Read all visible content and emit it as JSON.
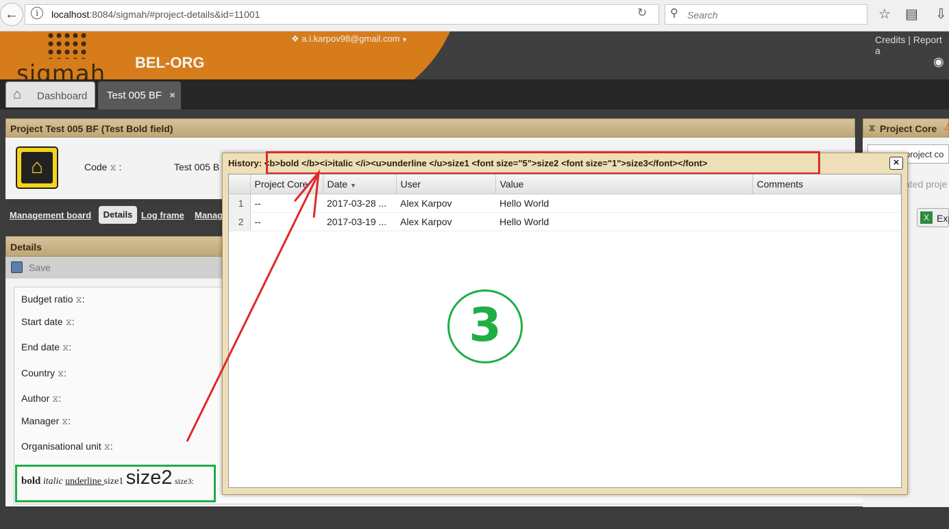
{
  "browser": {
    "url_host": "localhost",
    "url_rest": ":8084/sigmah/#project-details&id=11001",
    "search_placeholder": "Search"
  },
  "header": {
    "logo_text": "sigmah",
    "org": "BEL-ORG",
    "user": "a.i.karpov98@gmail.com",
    "links": "Credits | Report a"
  },
  "tabs": {
    "dashboard": "Dashboard",
    "project": "Test 005 BF"
  },
  "project": {
    "title": "Project Test 005 BF (Test Bold field)",
    "code_label": "Code",
    "code_value": "Test 005 B"
  },
  "subtabs": [
    "Management board",
    "Details",
    "Log frame",
    "Manag"
  ],
  "details": {
    "title": "Details",
    "save_label": "Save",
    "fields": [
      "Budget ratio",
      "Start date",
      "End date",
      "Country",
      "Author",
      "Manager",
      "Organisational unit"
    ],
    "rich": {
      "bold": "bold",
      "italic": "italic",
      "underline": "underline ",
      "size1": "size1",
      "size2": "size2",
      "size3": "size3:"
    }
  },
  "right_panel": {
    "title": "Project Core",
    "select_text": "project co",
    "stated": "ated proje",
    "export": "Exp"
  },
  "dialog": {
    "title": "History: <b>bold </b><i>italic </i><u>underline </u>size1 <font size=\"5\">size2 <font size=\"1\">size3</font></font>",
    "columns": [
      "Project Core",
      "Date",
      "User",
      "Value",
      "Comments"
    ],
    "rows": [
      {
        "n": "1",
        "core": "--",
        "date": "2017-03-28 ...",
        "user": "Alex Karpov",
        "value": "Hello World",
        "comments": ""
      },
      {
        "n": "2",
        "core": "--",
        "date": "2017-03-19 ...",
        "user": "Alex Karpov",
        "value": "Hello World",
        "comments": ""
      }
    ]
  },
  "annotation": {
    "number": "3"
  },
  "colors": {
    "annotation_red": "#e02828",
    "annotation_green": "#1fae44",
    "header_tan": "#d6c39a"
  }
}
